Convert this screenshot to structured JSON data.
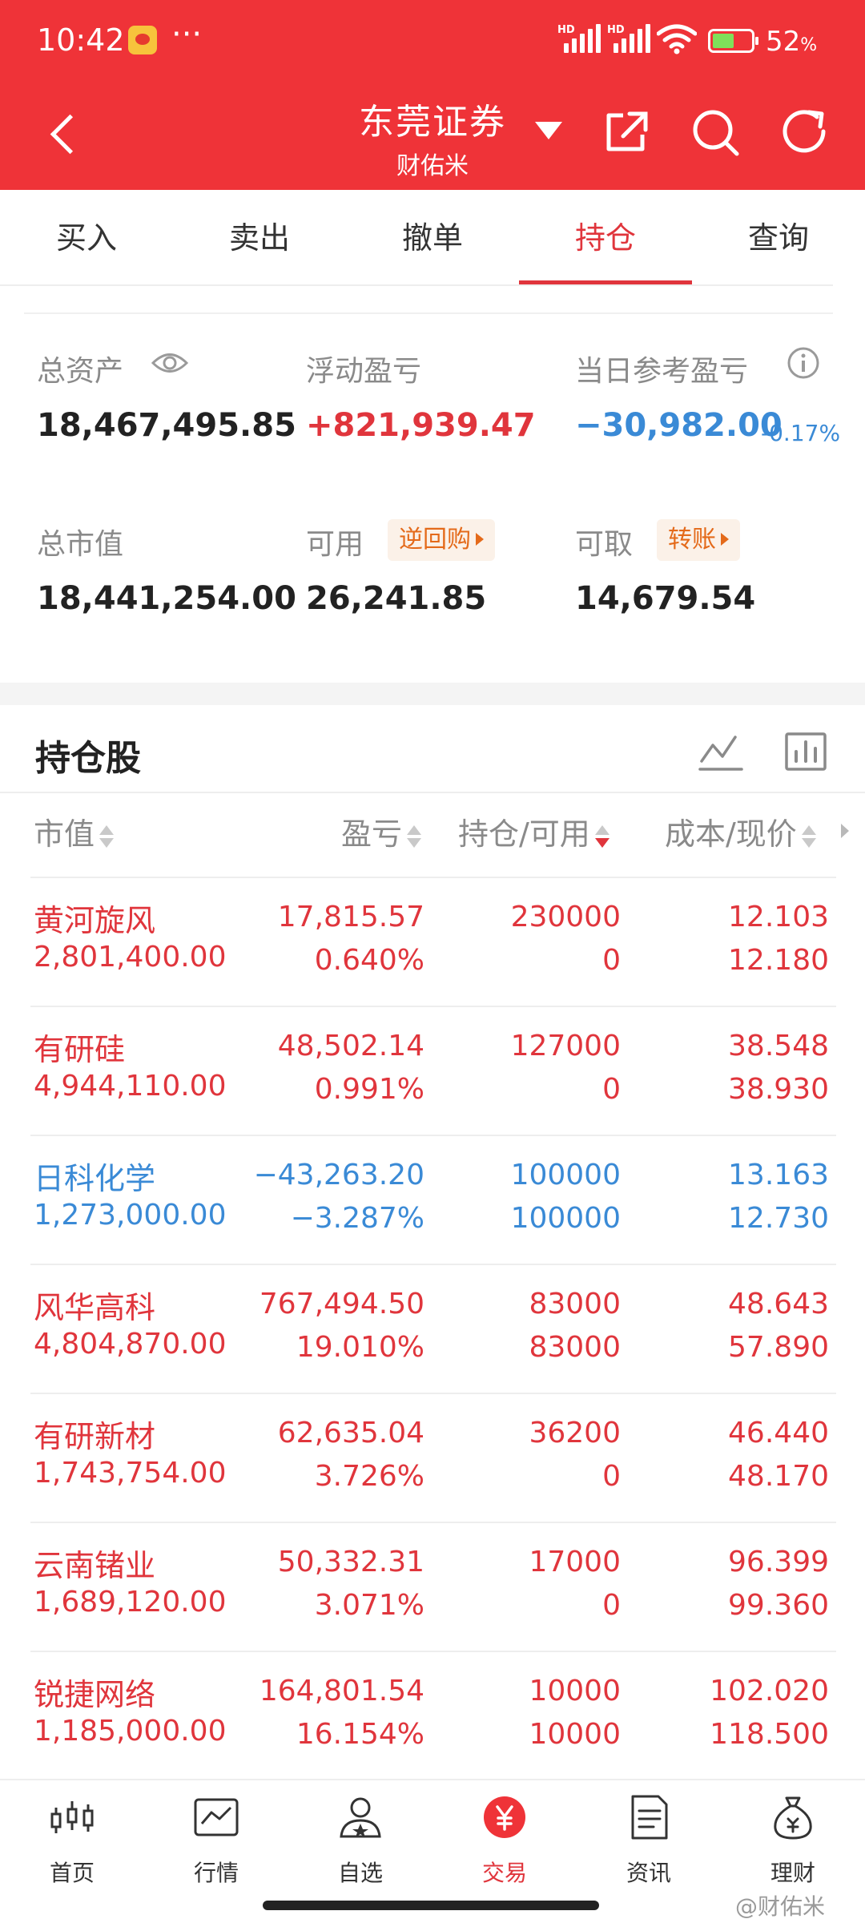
{
  "status_bar": {
    "time": "10:42",
    "dots": "···",
    "hd1": "HD",
    "hd2": "HD",
    "battery_percent": "52",
    "battery_unit": "%"
  },
  "header": {
    "title": "东莞证券",
    "subtitle": "财佑米",
    "share_icon": "share-icon",
    "search_icon": "search-icon",
    "refresh_icon": "refresh-icon"
  },
  "tabs": [
    {
      "label": "买入"
    },
    {
      "label": "卖出"
    },
    {
      "label": "撤单"
    },
    {
      "label": "持仓",
      "active": true
    },
    {
      "label": "查询"
    }
  ],
  "summary": {
    "total_assets_label": "总资产",
    "total_assets": "18,467,495.85",
    "floating_pl_label": "浮动盈亏",
    "floating_pl": "+821,939.47",
    "daily_pl_label": "当日参考盈亏",
    "daily_pl": "−30,982.00",
    "daily_pl_pct": "-0.17%",
    "market_value_label": "总市值",
    "market_value": "18,441,254.00",
    "available_label": "可用",
    "available": "26,241.85",
    "reverse_repo": "逆回购",
    "withdrawable_label": "可取",
    "withdrawable": "14,679.54",
    "transfer": "转账"
  },
  "holdings": {
    "title": "持仓股",
    "columns": {
      "market_value": "市值",
      "pl": "盈亏",
      "position": "持仓/可用",
      "cost_price": "成本/现价"
    },
    "rows": [
      {
        "name": "黄河旋风",
        "market_value": "2,801,400.00",
        "pl": "17,815.57",
        "pl_pct": "0.640%",
        "qty": "230000",
        "avail": "0",
        "cost": "12.103",
        "price": "12.180",
        "color": "#e0353c"
      },
      {
        "name": "有研硅",
        "market_value": "4,944,110.00",
        "pl": "48,502.14",
        "pl_pct": "0.991%",
        "qty": "127000",
        "avail": "0",
        "cost": "38.548",
        "price": "38.930",
        "color": "#e0353c"
      },
      {
        "name": "日科化学",
        "market_value": "1,273,000.00",
        "pl": "−43,263.20",
        "pl_pct": "−3.287%",
        "qty": "100000",
        "avail": "100000",
        "cost": "13.163",
        "price": "12.730",
        "color": "#3a8ad6"
      },
      {
        "name": "风华高科",
        "market_value": "4,804,870.00",
        "pl": "767,494.50",
        "pl_pct": "19.010%",
        "qty": "83000",
        "avail": "83000",
        "cost": "48.643",
        "price": "57.890",
        "color": "#e0353c"
      },
      {
        "name": "有研新材",
        "market_value": "1,743,754.00",
        "pl": "62,635.04",
        "pl_pct": "3.726%",
        "qty": "36200",
        "avail": "0",
        "cost": "46.440",
        "price": "48.170",
        "color": "#e0353c"
      },
      {
        "name": "云南锗业",
        "market_value": "1,689,120.00",
        "pl": "50,332.31",
        "pl_pct": "3.071%",
        "qty": "17000",
        "avail": "0",
        "cost": "96.399",
        "price": "99.360",
        "color": "#e0353c"
      },
      {
        "name": "锐捷网络",
        "market_value": "1,185,000.00",
        "pl": "164,801.54",
        "pl_pct": "16.154%",
        "qty": "10000",
        "avail": "10000",
        "cost": "102.020",
        "price": "118.500",
        "color": "#e0353c"
      }
    ]
  },
  "bottom_nav": [
    {
      "label": "首页",
      "icon": "candlestick-icon"
    },
    {
      "label": "行情",
      "icon": "chart-icon"
    },
    {
      "label": "自选",
      "icon": "user-star-icon"
    },
    {
      "label": "交易",
      "icon": "yuan-icon",
      "active": true
    },
    {
      "label": "资讯",
      "icon": "news-icon"
    },
    {
      "label": "理财",
      "icon": "moneybag-icon"
    }
  ],
  "watermark": "@财佑米",
  "colors": {
    "brand_red": "#ef3338",
    "up": "#e0353c",
    "down": "#3a8ad6",
    "tag_orange": "#e46a1a"
  }
}
